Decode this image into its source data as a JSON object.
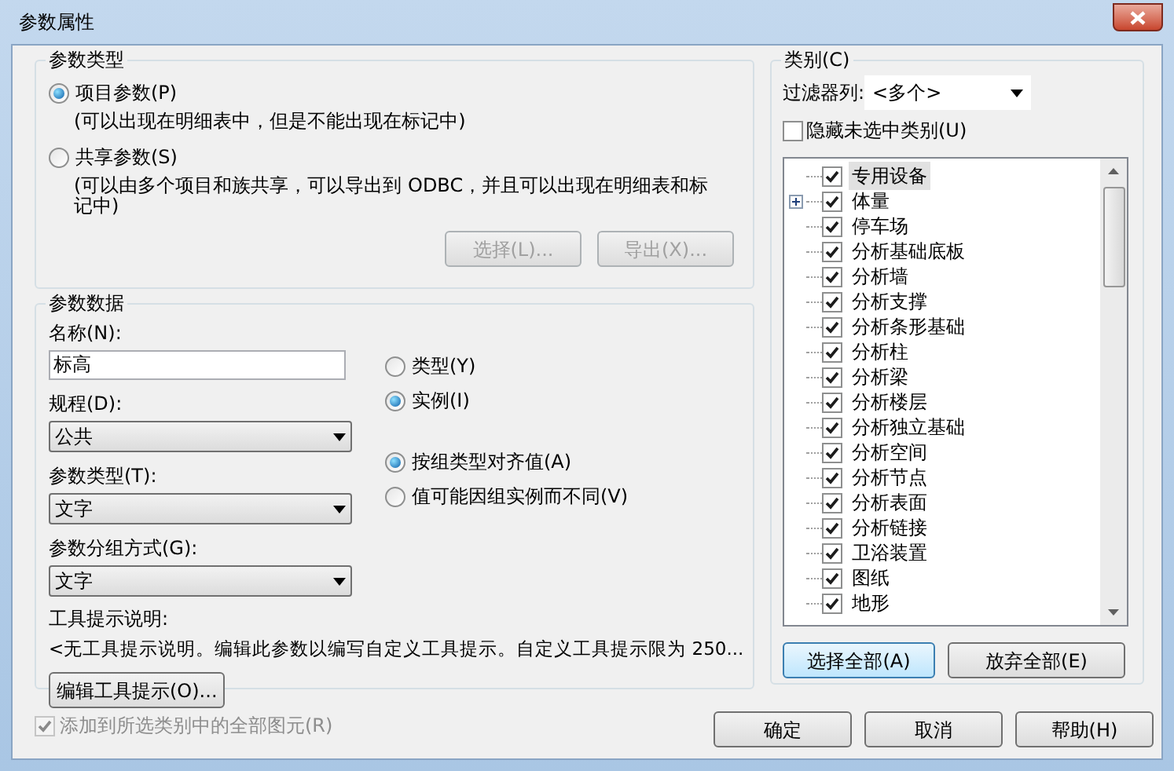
{
  "window": {
    "title": "参数属性"
  },
  "parameter_type": {
    "title": "参数类型",
    "options": [
      {
        "label": "项目参数(P)",
        "description": "(可以出现在明细表中，但是不能出现在标记中)",
        "selected": true
      },
      {
        "label": "共享参数(S)",
        "description": "(可以由多个项目和族共享，可以导出到 ODBC，并且可以出现在明细表和标记中)",
        "selected": false
      }
    ],
    "buttons": [
      {
        "label": "选择(L)...",
        "disabled": true
      },
      {
        "label": "导出(X)...",
        "disabled": true
      }
    ]
  },
  "parameter_data": {
    "title": "参数数据",
    "name": {
      "label": "名称(N):",
      "value": "标高"
    },
    "fields": [
      {
        "label": "规程(D):",
        "value": "公共"
      },
      {
        "label": "参数类型(T):",
        "value": "文字"
      },
      {
        "label": "参数分组方式(G):",
        "value": "文字"
      }
    ],
    "scope_options": [
      {
        "label": "类型(Y)",
        "selected": false
      },
      {
        "label": "实例(I)",
        "selected": true
      }
    ],
    "group_options": [
      {
        "label": "按组类型对齐值(A)",
        "selected": true
      },
      {
        "label": "值可能因组实例而不同(V)",
        "selected": false
      }
    ],
    "tooltip_label": "工具提示说明:",
    "tooltip_text": "<无工具提示说明。编辑此参数以编写自定义工具提示。自定义工具提示限为 250...",
    "edit_button": "编辑工具提示(O)..."
  },
  "categories": {
    "title": "类别(C)",
    "filter_label": "过滤器列:",
    "filter_value": "<多个>",
    "hide_unchecked": {
      "label": "隐藏未选中类别(U)",
      "checked": false
    },
    "items": [
      {
        "label": "专用设备",
        "checked": true,
        "expandable": false,
        "selected": true
      },
      {
        "label": "体量",
        "checked": true,
        "expandable": true,
        "selected": false
      },
      {
        "label": "停车场",
        "checked": true,
        "expandable": false,
        "selected": false
      },
      {
        "label": "分析基础底板",
        "checked": true,
        "expandable": false,
        "selected": false
      },
      {
        "label": "分析墙",
        "checked": true,
        "expandable": false,
        "selected": false
      },
      {
        "label": "分析支撑",
        "checked": true,
        "expandable": false,
        "selected": false
      },
      {
        "label": "分析条形基础",
        "checked": true,
        "expandable": false,
        "selected": false
      },
      {
        "label": "分析柱",
        "checked": true,
        "expandable": false,
        "selected": false
      },
      {
        "label": "分析梁",
        "checked": true,
        "expandable": false,
        "selected": false
      },
      {
        "label": "分析楼层",
        "checked": true,
        "expandable": false,
        "selected": false
      },
      {
        "label": "分析独立基础",
        "checked": true,
        "expandable": false,
        "selected": false
      },
      {
        "label": "分析空间",
        "checked": true,
        "expandable": false,
        "selected": false
      },
      {
        "label": "分析节点",
        "checked": true,
        "expandable": false,
        "selected": false
      },
      {
        "label": "分析表面",
        "checked": true,
        "expandable": false,
        "selected": false
      },
      {
        "label": "分析链接",
        "checked": true,
        "expandable": false,
        "selected": false
      },
      {
        "label": "卫浴装置",
        "checked": true,
        "expandable": false,
        "selected": false
      },
      {
        "label": "图纸",
        "checked": true,
        "expandable": false,
        "selected": false
      },
      {
        "label": "地形",
        "checked": true,
        "expandable": false,
        "selected": false
      }
    ],
    "buttons": [
      "选择全部(A)",
      "放弃全部(E)"
    ]
  },
  "add_to_all": {
    "label": "添加到所选类别中的全部图元(R)",
    "checked": true,
    "disabled": true
  },
  "footer_buttons": [
    "确定",
    "取消",
    "帮助(H)"
  ]
}
